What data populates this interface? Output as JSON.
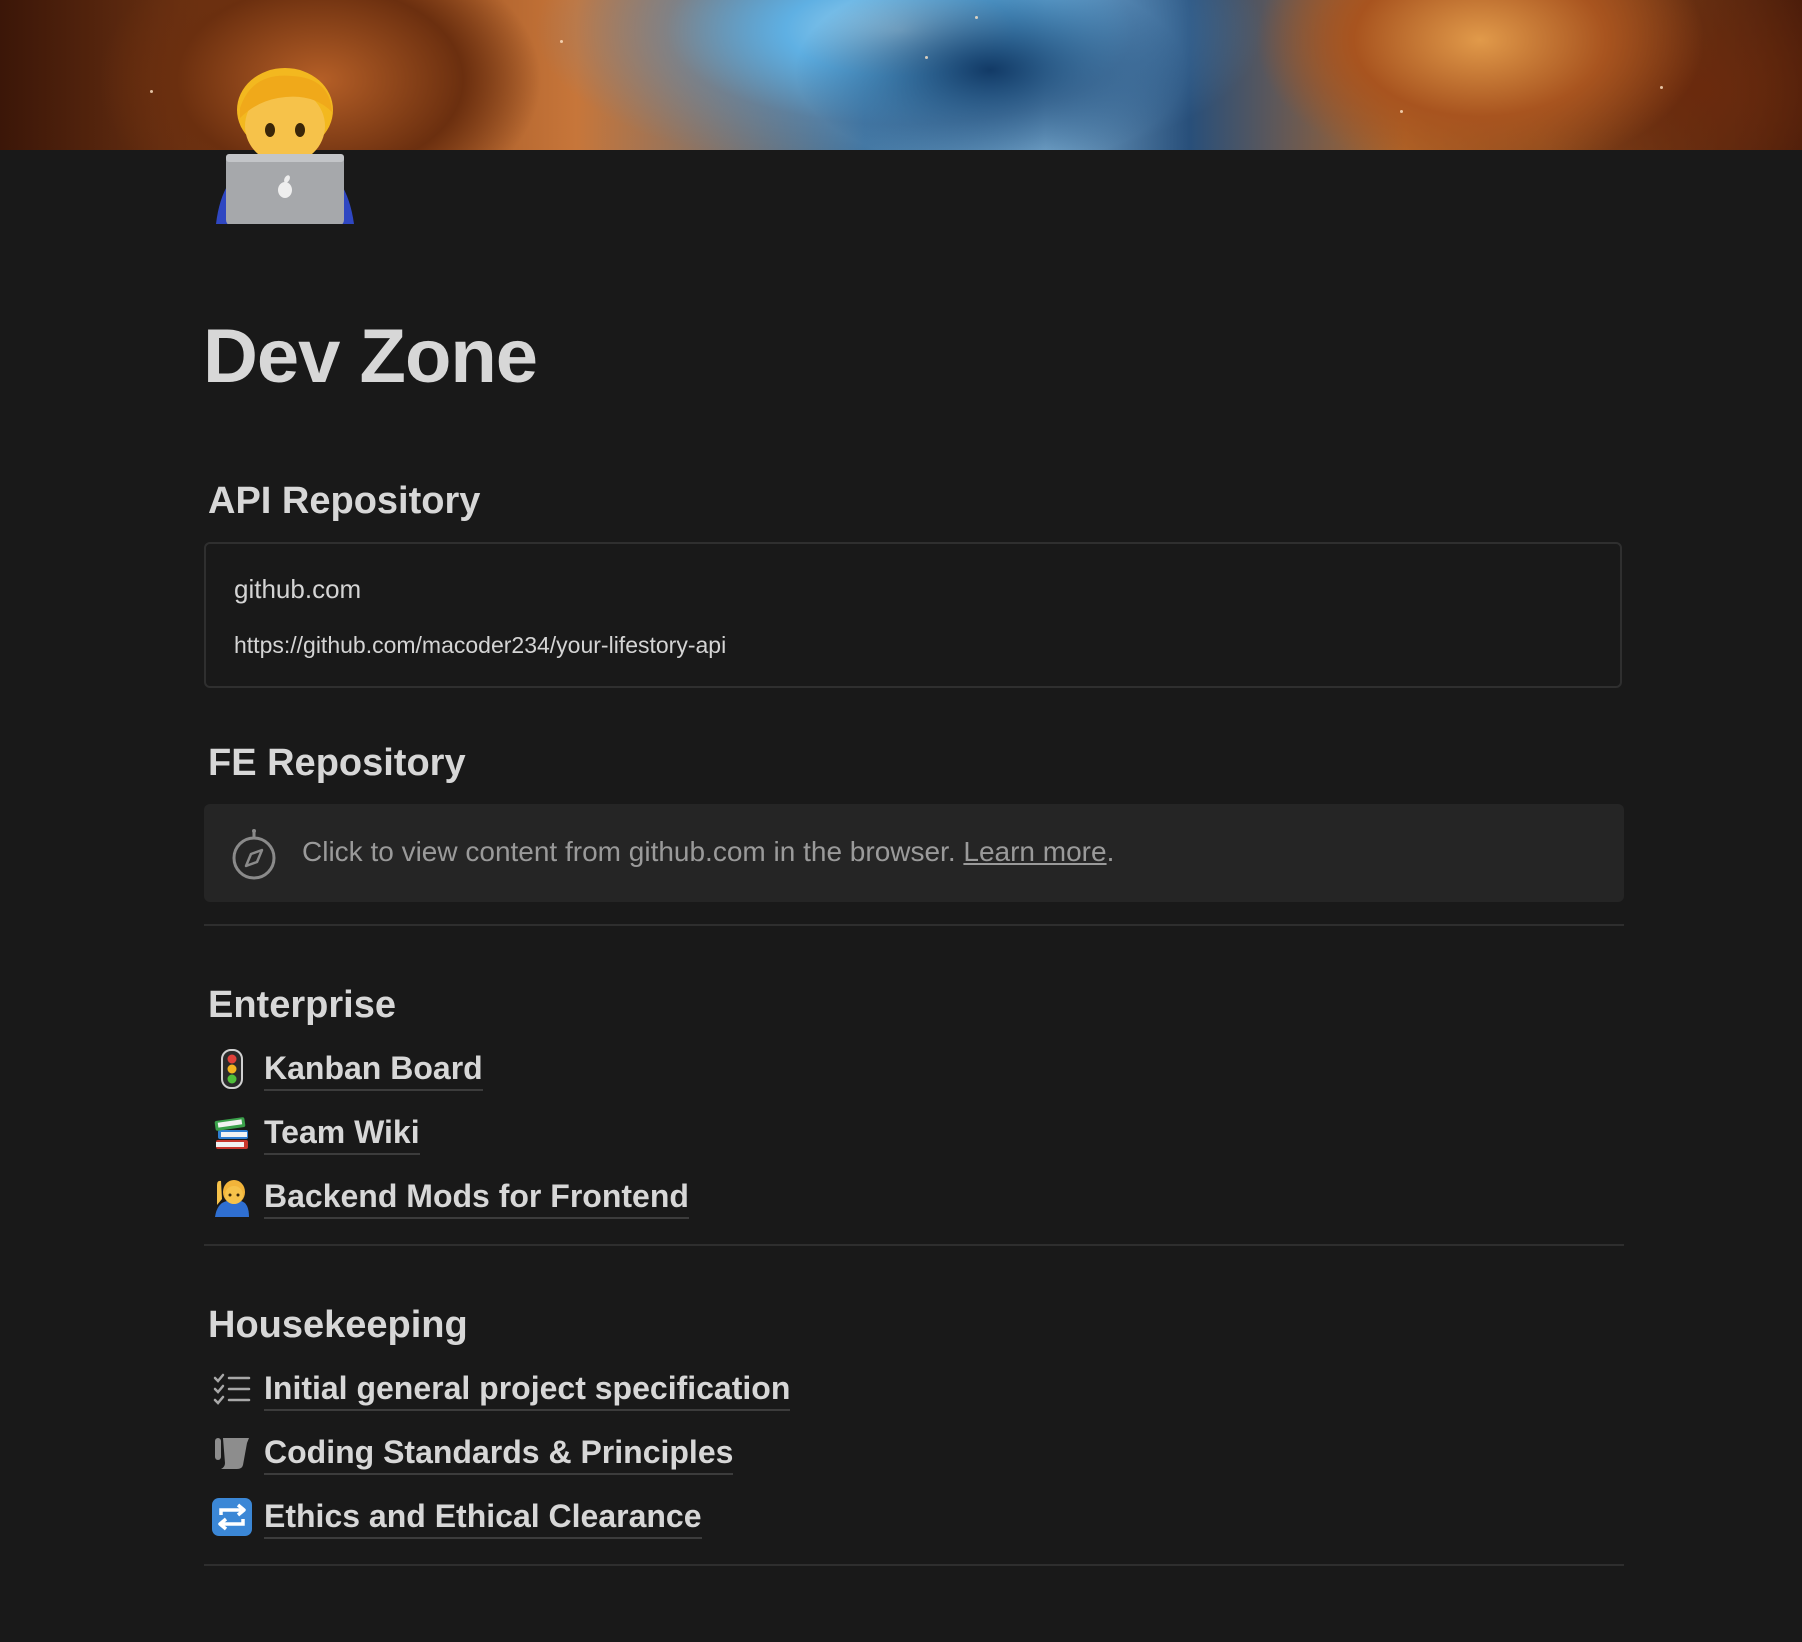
{
  "page": {
    "title": "Dev Zone",
    "icon": "technologist-laptop-emoji"
  },
  "sections": {
    "api": {
      "heading": "API Repository",
      "bookmark": {
        "title": "github.com",
        "url": "https://github.com/macoder234/your-lifestory-api"
      }
    },
    "fe": {
      "heading": "FE Repository",
      "embed": {
        "text": "Click to view content from github.com in the browser. ",
        "link": "Learn more",
        "trail": "."
      }
    },
    "enterprise": {
      "heading": "Enterprise",
      "items": [
        {
          "icon": "traffic-light-icon",
          "label": "Kanban Board"
        },
        {
          "icon": "books-icon",
          "label": "Team Wiki"
        },
        {
          "icon": "person-raising-hand-icon",
          "label": "Backend Mods for Frontend"
        }
      ]
    },
    "housekeeping": {
      "heading": "Housekeeping",
      "items": [
        {
          "icon": "checklist-icon",
          "label": "Initial general project specification"
        },
        {
          "icon": "scroll-icon",
          "label": "Coding Standards & Principles"
        },
        {
          "icon": "repeat-icon",
          "label": "Ethics and Ethical Clearance"
        }
      ]
    }
  },
  "colors": {
    "background": "#191919",
    "text": "#d7d7d7",
    "muted": "#9a9a9a",
    "border": "#2f2f2f"
  }
}
